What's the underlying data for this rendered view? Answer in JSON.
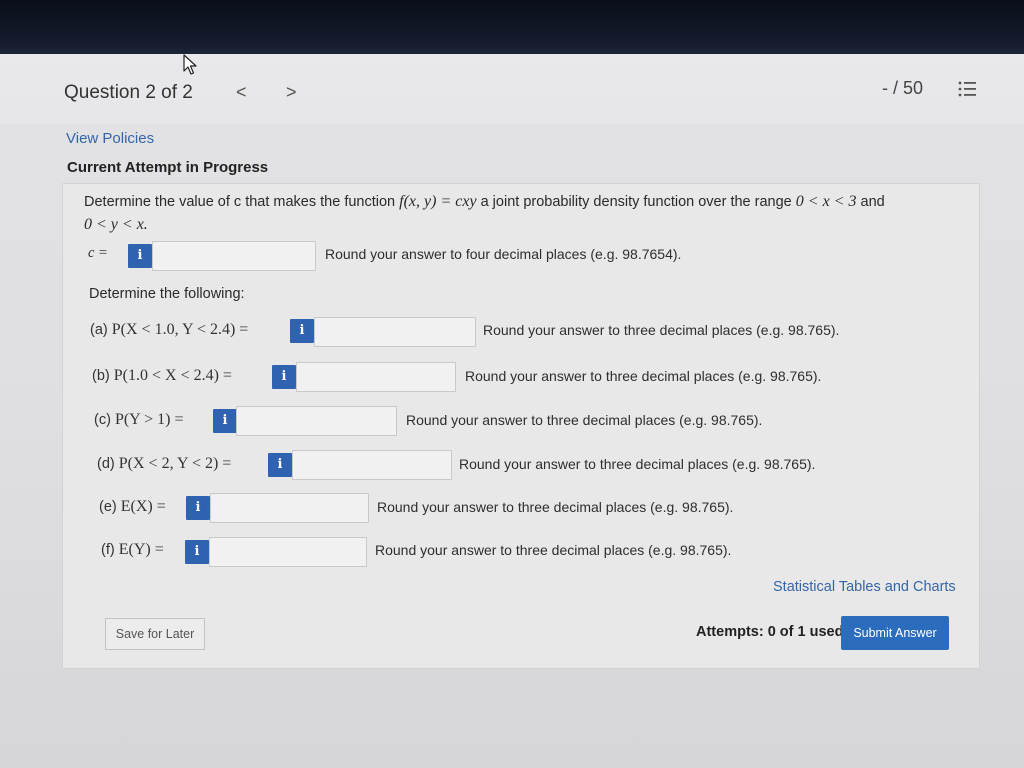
{
  "header": {
    "question_label": "Question 2 of 2",
    "prev": "<",
    "next": ">",
    "score": "- / 50",
    "menu_icon": "list-icon"
  },
  "view_policies": "View Policies",
  "status": "Current Attempt in Progress",
  "question": {
    "text_1": "Determine the value of c that makes the function",
    "math_1": "f(x, y) = cxy",
    "text_2": "a joint probability density function over the range",
    "math_2": "0 < x < 3",
    "text_3": "and",
    "math_3": "0 < y < x."
  },
  "c_answer": {
    "label": "c =",
    "info": "i",
    "value": "",
    "hint": "Round your answer to four decimal places (e.g. 98.7654)."
  },
  "subheading": "Determine the following:",
  "parts": [
    {
      "label": "(a)",
      "expr": "P(X < 1.0, Y < 2.4) =",
      "info": "i",
      "value": "",
      "hint": "Round your answer to three decimal places (e.g. 98.765)."
    },
    {
      "label": "(b)",
      "expr": "P(1.0 < X < 2.4) =",
      "info": "i",
      "value": "",
      "hint": "Round your answer to three decimal places (e.g. 98.765)."
    },
    {
      "label": "(c)",
      "expr": "P(Y > 1) =",
      "info": "i",
      "value": "",
      "hint": "Round your answer to three decimal places (e.g. 98.765)."
    },
    {
      "label": "(d)",
      "expr": "P(X < 2, Y < 2) =",
      "info": "i",
      "value": "",
      "hint": "Round your answer to three decimal places (e.g. 98.765)."
    },
    {
      "label": "(e)",
      "expr": "E(X) =",
      "info": "i",
      "value": "",
      "hint": "Round your answer to three decimal places (e.g. 98.765)."
    },
    {
      "label": "(f)",
      "expr": "E(Y) =",
      "info": "i",
      "value": "",
      "hint": "Round your answer to three decimal places (e.g. 98.765)."
    }
  ],
  "footer": {
    "tables_link": "Statistical Tables and Charts",
    "save": "Save for Later",
    "attempts": "Attempts: 0 of 1 used",
    "submit": "Submit Answer"
  },
  "colors": {
    "accent": "#2b6cbd",
    "info_button": "#2f62b0",
    "link": "#3465a8",
    "bezel": "#0b0f1a"
  }
}
